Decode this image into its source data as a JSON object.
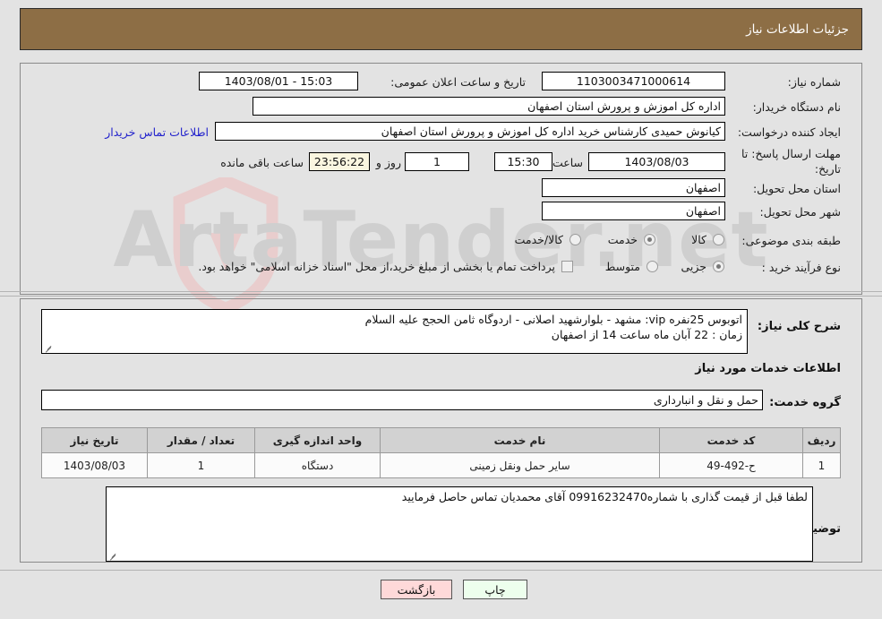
{
  "header": {
    "title": "جزئیات اطلاعات نیاز"
  },
  "top_section": {
    "need_number_label": "شماره نیاز:",
    "need_number_value": "1103003471000614",
    "announce_label": "تاریخ و ساعت اعلان عمومی:",
    "announce_value": "15:03 - 1403/08/01",
    "buyer_org_label": "نام دستگاه خریدار:",
    "buyer_org_value": "اداره کل اموزش و پرورش استان اصفهان",
    "creator_label": "ایجاد کننده درخواست:",
    "creator_value": "کیانوش حمیدی کارشناس خرید اداره کل اموزش و پرورش استان اصفهان",
    "contact_link": "اطلاعات تماس خریدار",
    "deadline_label_line1": "مهلت ارسال پاسخ: تا",
    "deadline_label_line2": "تاریخ:",
    "deadline_date": "1403/08/03",
    "deadline_hour_label": "ساعت",
    "deadline_hour_value": "15:30",
    "remaining_days_value": "1",
    "remaining_days_label": "روز و",
    "remaining_time_value": "23:56:22",
    "remaining_time_label": "ساعت باقی مانده",
    "province_label": "استان محل تحویل:",
    "province_value": "اصفهان",
    "city_label": "شهر محل تحویل:",
    "city_value": "اصفهان",
    "category_label": "طبقه بندی موضوعی:",
    "category_options": [
      {
        "label": "کالا",
        "selected": false
      },
      {
        "label": "خدمت",
        "selected": true
      },
      {
        "label": "کالا/خدمت",
        "selected": false
      }
    ],
    "process_label": "نوع فرآیند خرید :",
    "process_options": [
      {
        "label": "جزیی",
        "selected": true
      },
      {
        "label": "متوسط",
        "selected": false
      }
    ],
    "treasury_checkbox_label": "پرداخت تمام یا بخشی از مبلغ خرید،از محل \"اسناد خزانه اسلامی\" خواهد بود.",
    "treasury_checked": false
  },
  "description": {
    "label": "شرح کلی نیاز:",
    "line1": "اتوبوس 25نفره vip: مشهد - بلوارشهید اصلانی - اردوگاه ثامن الحجج علیه السلام",
    "line2": "زمان : 22 آبان ماه ساعت 14 از اصفهان"
  },
  "services": {
    "heading": "اطلاعات خدمات مورد نیاز",
    "group_label": "گروه خدمت:",
    "group_value": "حمل و نقل و انبارداری",
    "columns": [
      "ردیف",
      "کد خدمت",
      "نام خدمت",
      "واحد اندازه گیری",
      "تعداد / مقدار",
      "تاریخ نیاز"
    ],
    "rows": [
      {
        "radif": "1",
        "code": "ح-492-49",
        "name": "سایر حمل ونقل زمینی",
        "unit": "دستگاه",
        "qty": "1",
        "date": "1403/08/03"
      }
    ]
  },
  "buyer_notes": {
    "label": "توضیحات خریدار:",
    "text": "لطفا قبل از قیمت گذاری با شماره09916232470 آقای محمدیان تماس حاصل فرمایید"
  },
  "footer": {
    "print_label": "چاپ",
    "back_label": "بازگشت"
  },
  "watermark": {
    "text": "ArtaTender.net"
  },
  "colors": {
    "header_brown": "#8d6e45",
    "page_bg": "#e3e3e3",
    "link_blue": "#2222cc",
    "back_button_bg": "#ffd9d9",
    "print_button_bg": "#edffed",
    "countdown_bg": "#faf6e0"
  }
}
